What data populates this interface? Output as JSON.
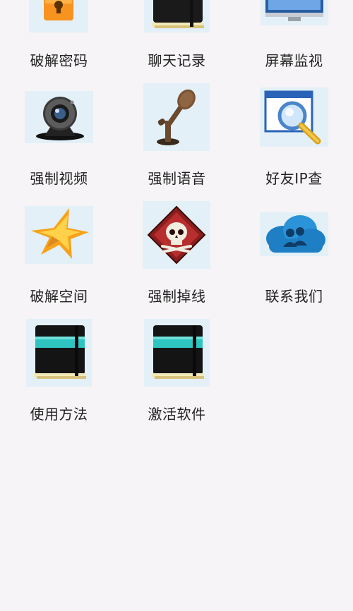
{
  "items": [
    {
      "label": "破解密码",
      "icon": "lock-icon"
    },
    {
      "label": "聊天记录",
      "icon": "notebook-icon"
    },
    {
      "label": "屏幕监视",
      "icon": "monitor-icon"
    },
    {
      "label": "强制视频",
      "icon": "webcam-icon"
    },
    {
      "label": "强制语音",
      "icon": "microphone-icon"
    },
    {
      "label": "好友IP查",
      "icon": "magnifier-window-icon"
    },
    {
      "label": "破解空间",
      "icon": "star-icon"
    },
    {
      "label": "强制掉线",
      "icon": "skull-icon"
    },
    {
      "label": "联系我们",
      "icon": "cloud-users-icon"
    },
    {
      "label": "使用方法",
      "icon": "notebook-icon"
    },
    {
      "label": "激活软件",
      "icon": "notebook-icon"
    }
  ],
  "colors": {
    "background": "#f6f4f6",
    "icon_bg": "#e3f0f8",
    "label_text": "#222222"
  }
}
